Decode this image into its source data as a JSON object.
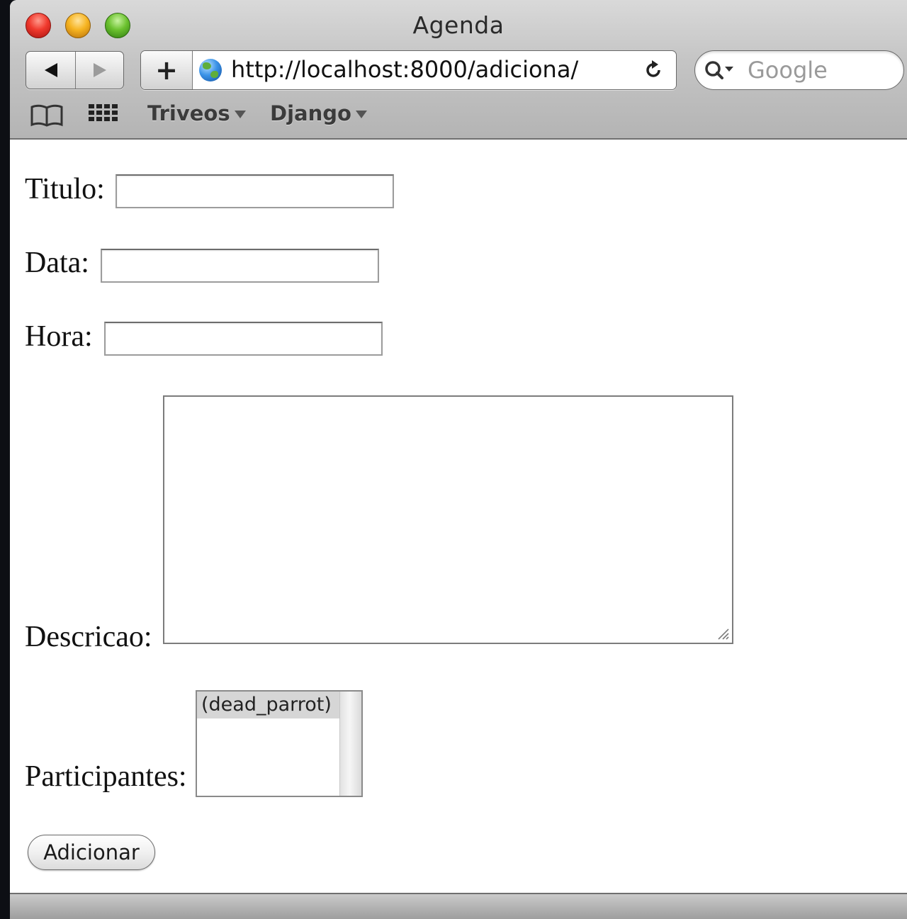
{
  "window": {
    "title": "Agenda"
  },
  "nav": {
    "back_icon": "back-arrow-icon",
    "forward_icon": "forward-arrow-icon"
  },
  "address": {
    "add_label": "+",
    "url": "http://localhost:8000/adiciona/",
    "site_icon": "globe-icon",
    "reload_icon": "reload-icon"
  },
  "search": {
    "placeholder": "Google",
    "icon": "search-icon"
  },
  "bookmarks": {
    "items": [
      {
        "label": "Triveos",
        "icon": "chevron-down-icon"
      },
      {
        "label": "Django",
        "icon": "chevron-down-icon"
      }
    ],
    "book_icon": "bookmarks-book-icon",
    "grid_icon": "top-sites-grid-icon"
  },
  "form": {
    "titulo_label": "Titulo:",
    "titulo_value": "",
    "data_label": "Data:",
    "data_value": "",
    "hora_label": "Hora:",
    "hora_value": "",
    "descricao_label": "Descricao:",
    "descricao_value": "",
    "participantes_label": "Participantes:",
    "participantes_options": [
      "(dead_parrot)"
    ],
    "submit_label": "Adicionar"
  },
  "colors": {
    "toolbar_top": "#d9d9d9",
    "toolbar_bottom": "#b4b4b4",
    "desktop": "#0d0f14",
    "selected_option": "#d6d6d6"
  }
}
